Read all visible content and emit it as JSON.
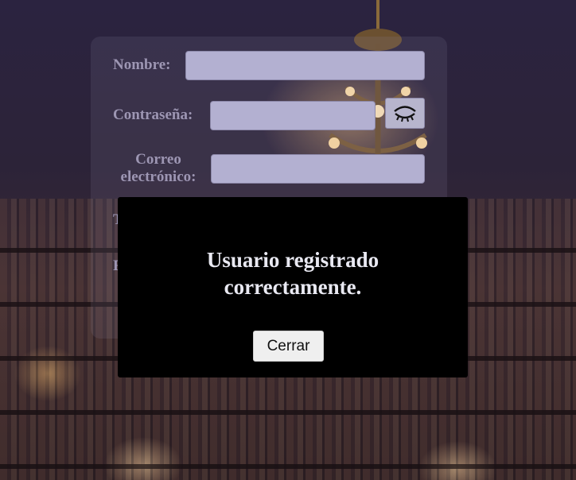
{
  "form": {
    "name_label": "Nombre:",
    "name_value": "",
    "password_label": "Contraseña:",
    "password_value": "",
    "password_toggle_icon": "closed-eye-icon",
    "email_label_line1": "Correo",
    "email_label_line2": "electrónico:",
    "email_value": "",
    "partial_label_1": "T",
    "partial_label_2": "F"
  },
  "modal": {
    "message": "Usuario registrado correctamente.",
    "close_label": "Cerrar"
  },
  "colors": {
    "label": "#9d96b3",
    "input_background": "#b3b0d1",
    "modal_background": "#000000",
    "modal_text": "#e9e9f2"
  }
}
